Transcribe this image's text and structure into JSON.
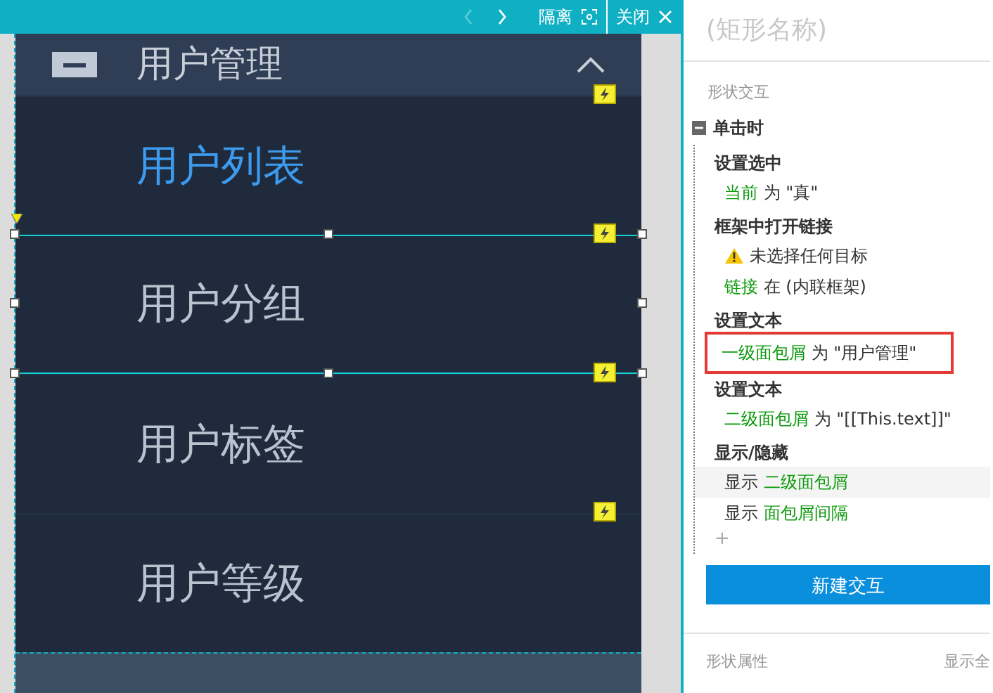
{
  "toolbar": {
    "prev_disabled": true,
    "isolate": "隔离",
    "close": "关闭"
  },
  "canvas": {
    "header": {
      "title": "用户管理"
    },
    "menu_items": [
      {
        "label": "用户列表",
        "selected": true,
        "editing": false
      },
      {
        "label": "用户分组",
        "selected": false,
        "editing": true
      },
      {
        "label": "用户标签",
        "selected": false,
        "editing": false
      },
      {
        "label": "用户等级",
        "selected": false,
        "editing": false
      }
    ]
  },
  "panel": {
    "shape_name": "(矩形名称)",
    "section_label": "形状交互",
    "event": {
      "label": "单击时",
      "expanded": true,
      "actions": [
        {
          "title": "设置选中",
          "lines": [
            {
              "kind": "text",
              "highlighted": false,
              "boxed": false,
              "parts": [
                {
                  "text": "当前",
                  "kind": "target"
                },
                {
                  "text": " 为 \"真\"",
                  "kind": "plain"
                }
              ]
            }
          ]
        },
        {
          "title": "框架中打开链接",
          "lines": [
            {
              "kind": "warning",
              "highlighted": false,
              "boxed": false,
              "parts": [
                {
                  "text": "未选择任何目标",
                  "kind": "plain"
                }
              ]
            },
            {
              "kind": "text",
              "highlighted": false,
              "boxed": false,
              "parts": [
                {
                  "text": "链接",
                  "kind": "target"
                },
                {
                  "text": " 在 (内联框架)",
                  "kind": "plain"
                }
              ]
            }
          ]
        },
        {
          "title": "设置文本",
          "lines": [
            {
              "kind": "text",
              "highlighted": false,
              "boxed": true,
              "parts": [
                {
                  "text": "一级面包屑",
                  "kind": "target"
                },
                {
                  "text": " 为 \"用户管理\"",
                  "kind": "plain"
                }
              ]
            }
          ]
        },
        {
          "title": "设置文本",
          "lines": [
            {
              "kind": "text",
              "highlighted": false,
              "boxed": false,
              "parts": [
                {
                  "text": "二级面包屑",
                  "kind": "target"
                },
                {
                  "text": " 为 \"[[This.text]]\"",
                  "kind": "plain"
                }
              ]
            }
          ]
        },
        {
          "title": "显示/隐藏",
          "lines": [
            {
              "kind": "text",
              "highlighted": true,
              "boxed": false,
              "parts": [
                {
                  "text": "显示 ",
                  "kind": "plain"
                },
                {
                  "text": "二级面包屑",
                  "kind": "target"
                }
              ]
            },
            {
              "kind": "text",
              "highlighted": false,
              "boxed": false,
              "parts": [
                {
                  "text": "显示 ",
                  "kind": "plain"
                },
                {
                  "text": "面包屑间隔",
                  "kind": "target"
                }
              ]
            }
          ]
        }
      ]
    },
    "add": "+",
    "new_button": "新建交互",
    "footer_left": "形状属性",
    "footer_right": "显示全"
  }
}
